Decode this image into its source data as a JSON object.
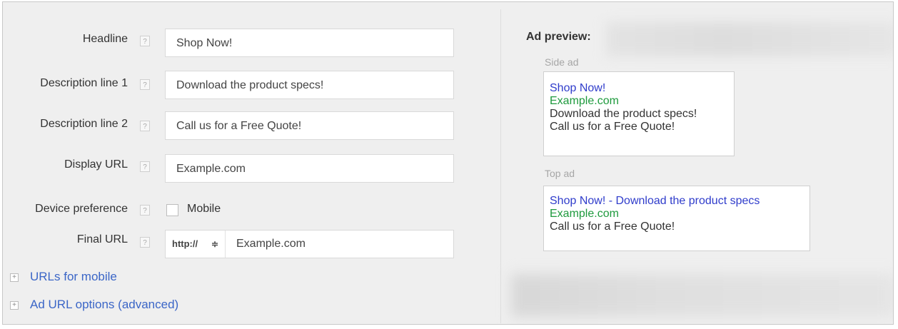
{
  "form": {
    "help_glyph": "?",
    "headline": {
      "label": "Headline",
      "value": "Shop Now!"
    },
    "description_1": {
      "label": "Description line 1",
      "value": "Download the product specs!"
    },
    "description_2": {
      "label": "Description line 2",
      "value": "Call us for a Free Quote!"
    },
    "display_url": {
      "label": "Display URL",
      "value": "Example.com"
    },
    "device_preference": {
      "label": "Device preference",
      "checkbox_label": "Mobile",
      "checked": false
    },
    "final_url": {
      "label": "Final URL",
      "protocol": "http://",
      "protocol_arrows": "≑",
      "value": "Example.com"
    },
    "expand_glyph": "+",
    "links": [
      {
        "label": "URLs for mobile"
      },
      {
        "label": "Ad URL options (advanced)"
      }
    ]
  },
  "preview": {
    "title": "Ad preview:",
    "side_ad": {
      "label": "Side ad",
      "headline": "Shop Now!",
      "display_url": "Example.com",
      "line1": "Download the product specs!",
      "line2": "Call us for a Free Quote!"
    },
    "top_ad": {
      "label": "Top ad",
      "headline": "Shop Now! - Download the product specs",
      "display_url": "Example.com",
      "line1": "Call us for a Free Quote!"
    }
  },
  "colors": {
    "background": "#efefef",
    "link": "#3b66c7",
    "ad_headline": "#2f3ccb",
    "ad_url": "#1e9a3d"
  }
}
